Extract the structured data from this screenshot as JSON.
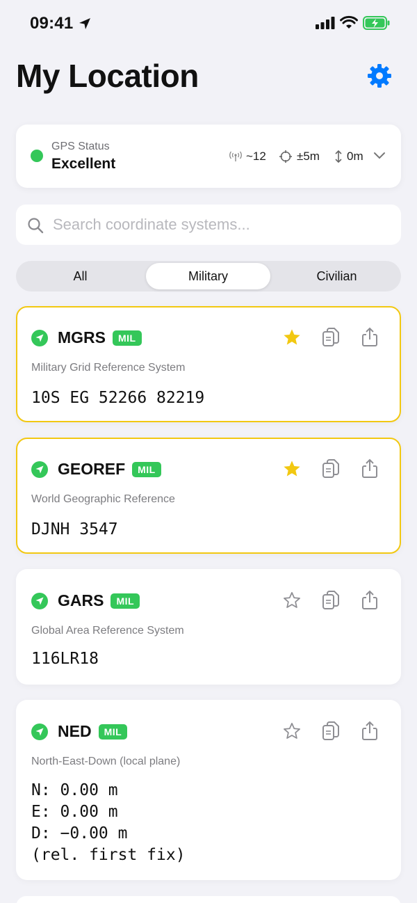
{
  "status_bar": {
    "time": "09:41"
  },
  "header": {
    "title": "My Location"
  },
  "gps": {
    "label": "GPS Status",
    "value": "Excellent",
    "satellites": "~12",
    "accuracy": "±5m",
    "altitude": "0m"
  },
  "search": {
    "placeholder": "Search coordinate systems..."
  },
  "segments": [
    "All",
    "Military",
    "Civilian"
  ],
  "selected_segment": "Military",
  "colors": {
    "accent": "#007aff",
    "green": "#34c759",
    "favorite": "#f2c811"
  },
  "systems": [
    {
      "name": "MGRS",
      "badge": "MIL",
      "subtitle": "Military Grid Reference System",
      "value": "10S EG 52266 82219",
      "favorite": true
    },
    {
      "name": "GEOREF",
      "badge": "MIL",
      "subtitle": "World Geographic Reference",
      "value": "DJNH 3547",
      "favorite": true
    },
    {
      "name": "GARS",
      "badge": "MIL",
      "subtitle": "Global Area Reference System",
      "value": "116LR18",
      "favorite": false
    },
    {
      "name": "NED",
      "badge": "MIL",
      "subtitle": "North-East-Down (local plane)",
      "value": "N: 0.00 m\nE: 0.00 m\nD: −0.00 m\n(rel. first fix)",
      "favorite": false
    }
  ]
}
